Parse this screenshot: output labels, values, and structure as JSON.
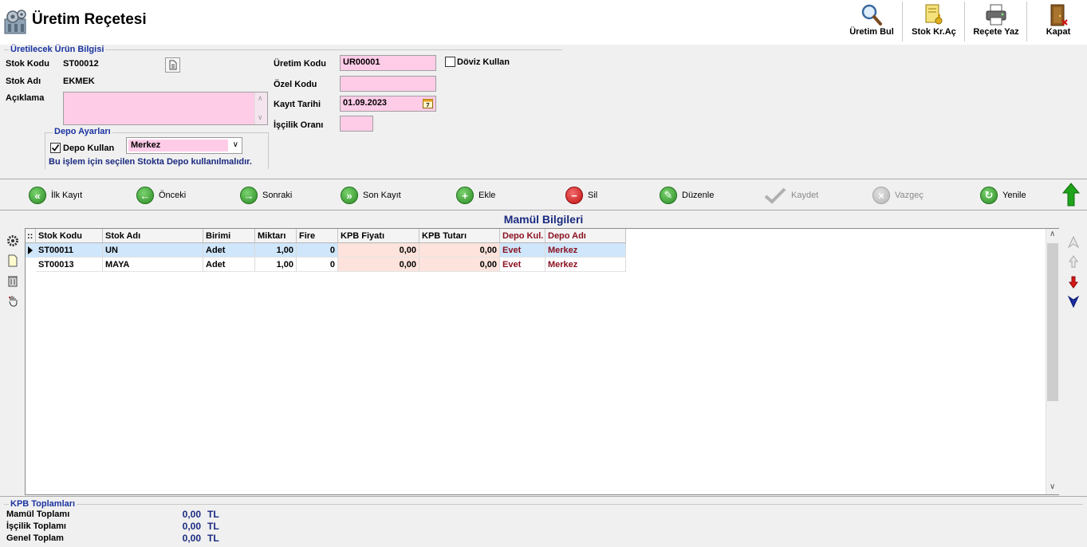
{
  "window": {
    "title": "Üretim Reçetesi"
  },
  "toolbar": {
    "uretim_bul": "Üretim Bul",
    "stok_kr_ac": "Stok Kr.Aç",
    "recete_yaz": "Reçete Yaz",
    "kapat": "Kapat"
  },
  "urun_bilgisi": {
    "group_title": "Üretilecek Ürün Bilgisi",
    "stok_kodu_label": "Stok Kodu",
    "stok_kodu_value": "ST00012",
    "stok_adi_label": "Stok Adı",
    "stok_adi_value": "EKMEK",
    "aciklama_label": "Açıklama",
    "aciklama_value": "",
    "uretim_kodu_label": "Üretim Kodu",
    "uretim_kodu_value": "UR00001",
    "ozel_kodu_label": "Özel Kodu",
    "ozel_kodu_value": "",
    "kayit_tarihi_label": "Kayıt Tarihi",
    "kayit_tarihi_value": "01.09.2023",
    "iscilik_orani_label": "İşçilik Oranı",
    "iscilik_orani_value": "",
    "doviz_kullan_label": "Döviz Kullan",
    "doviz_kullan_checked": false
  },
  "depo": {
    "group_title": "Depo Ayarları",
    "depo_kullan_label": "Depo Kullan",
    "depo_kullan_checked": true,
    "depo_selected": "Merkez",
    "note": "Bu işlem için seçilen Stokta Depo kullanılmalıdır."
  },
  "nav": {
    "ilk_kayit": "İlk Kayıt",
    "onceki": "Önceki",
    "sonraki": "Sonraki",
    "son_kayit": "Son Kayıt",
    "ekle": "Ekle",
    "sil": "Sil",
    "duzenle": "Düzenle",
    "kaydet": "Kaydet",
    "vazgec": "Vazgeç",
    "yenile": "Yenile"
  },
  "grid": {
    "title": "Mamül Bilgileri",
    "indicator_header": "::",
    "columns": [
      "Stok Kodu",
      "Stok Adı",
      "Birimi",
      "Miktarı",
      "Fire",
      "KPB Fiyatı",
      "KPB Tutarı",
      "Depo Kul.",
      "Depo Adı"
    ],
    "rows": [
      [
        "ST00011",
        "UN",
        "Adet",
        "1,00",
        "0",
        "0,00",
        "0,00",
        "Evet",
        "Merkez"
      ],
      [
        "ST00013",
        "MAYA",
        "Adet",
        "1,00",
        "0",
        "0,00",
        "0,00",
        "Evet",
        "Merkez"
      ]
    ],
    "selected_row": 0
  },
  "totals": {
    "group_title": "KPB Toplamları",
    "mamul_label": "Mamül Toplamı",
    "mamul_value": "0,00",
    "iscilik_label": "İşçilik Toplamı",
    "iscilik_value": "0,00",
    "genel_label": "Genel Toplam",
    "genel_value": "0,00",
    "currency": "TL"
  },
  "colors": {
    "field_pink": "#ffcce8",
    "title_blue": "#1a2a80",
    "maroon": "#8a0f1f",
    "selected_row": "#cfe6fb",
    "peach": "#fde3dc"
  }
}
